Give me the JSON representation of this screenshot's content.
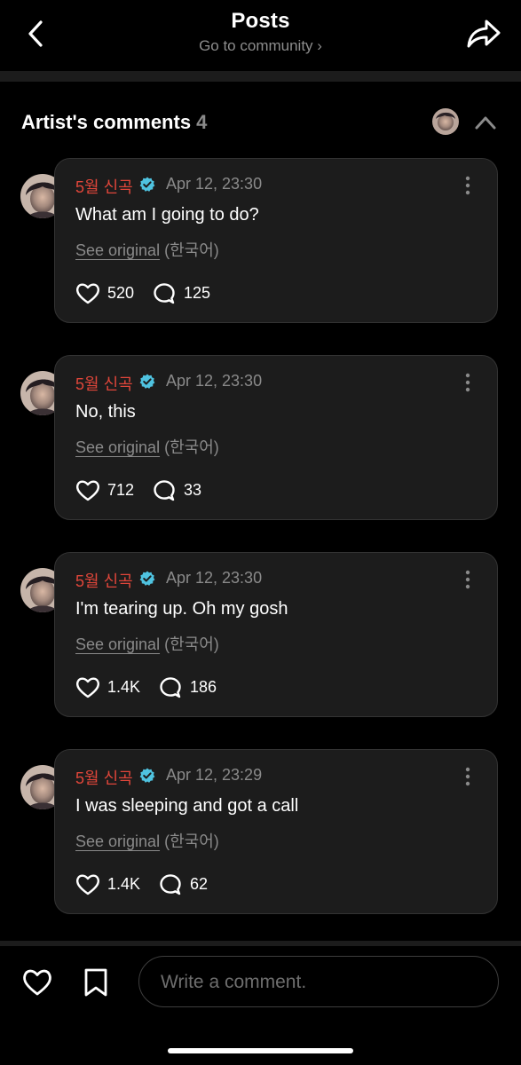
{
  "header": {
    "title": "Posts",
    "subtitle": "Go to community ›"
  },
  "section": {
    "title": "Artist's comments",
    "count": "4"
  },
  "comments": [
    {
      "author": "5월 신곡",
      "time": "Apr 12, 23:30",
      "text": "What am I going to do?",
      "see_original": "See original",
      "language": "(한국어)",
      "likes": "520",
      "replies": "125"
    },
    {
      "author": "5월 신곡",
      "time": "Apr 12, 23:30",
      "text": "No, this",
      "see_original": "See original",
      "language": "(한국어)",
      "likes": "712",
      "replies": "33"
    },
    {
      "author": "5월 신곡",
      "time": "Apr 12, 23:30",
      "text": "I'm tearing up. Oh my gosh",
      "see_original": "See original",
      "language": "(한국어)",
      "likes": "1.4K",
      "replies": "186"
    },
    {
      "author": "5월 신곡",
      "time": "Apr 12, 23:29",
      "text": "I was sleeping and got a call",
      "see_original": "See original",
      "language": "(한국어)",
      "likes": "1.4K",
      "replies": "62"
    }
  ],
  "composer": {
    "placeholder": "Write a comment."
  },
  "icons": {
    "back": "chevron-left-icon",
    "share": "share-icon",
    "collapse": "chevron-up-icon",
    "verified": "verified-badge-icon",
    "more": "more-vertical-icon",
    "like": "heart-icon",
    "reply": "comment-bubble-icon",
    "bookmark": "bookmark-icon"
  },
  "colors": {
    "author": "#e0463a",
    "verified": "#4fc3e0",
    "background": "#000000",
    "card": "#1c1c1c",
    "muted": "#8a8a8a"
  }
}
